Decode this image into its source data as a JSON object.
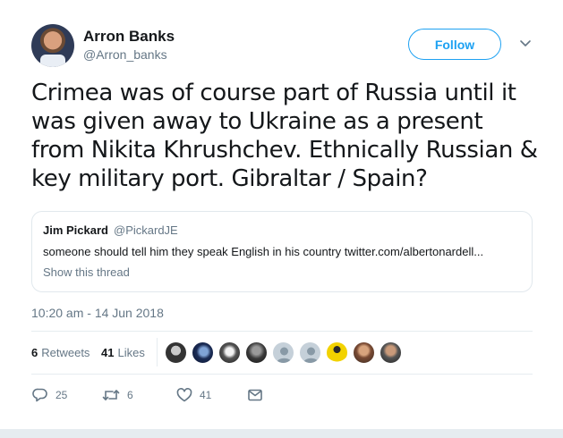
{
  "user": {
    "name": "Arron Banks",
    "handle": "@Arron_banks",
    "follow_label": "Follow"
  },
  "tweet": {
    "text": "Crimea was of course part of Russia until it was given away to Ukraine as a present from Nikita Khrushchev. Ethnically Russian & key military port. Gibraltar / Spain?",
    "timestamp": "10:20 am - 14 Jun 2018"
  },
  "quoted": {
    "name": "Jim Pickard",
    "handle": "@PickardJE",
    "text": "someone should tell him they speak English in his country twitter.com/albertonardell...",
    "show_thread": "Show this thread"
  },
  "stats": {
    "retweets_count": "6",
    "retweets_label": "Retweets",
    "likes_count": "41",
    "likes_label": "Likes"
  },
  "liker_avatars": [
    "photo",
    "photo",
    "photo",
    "photo",
    "default-egg",
    "default-egg",
    "photo",
    "photo",
    "photo"
  ],
  "actions": {
    "reply_count": "25",
    "retweet_count": "6",
    "like_count": "41"
  },
  "icons": [
    "chevron-down-icon",
    "reply-icon",
    "retweet-icon",
    "like-icon",
    "message-icon"
  ],
  "colors": {
    "accent": "#1da1f2",
    "secondary_text": "#657786",
    "primary_text": "#14171a"
  }
}
